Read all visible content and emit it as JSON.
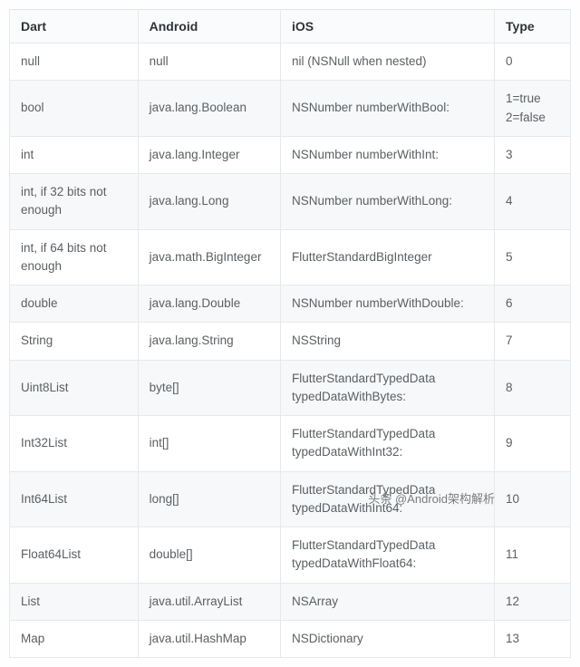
{
  "table": {
    "headers": [
      "Dart",
      "Android",
      "iOS",
      "Type"
    ],
    "rows": [
      {
        "dart": "null",
        "android": "null",
        "ios": "nil (NSNull when nested)",
        "type": "0"
      },
      {
        "dart": "bool",
        "android": "java.lang.Boolean",
        "ios": "NSNumber numberWithBool:",
        "type": "1=true\n2=false"
      },
      {
        "dart": "int",
        "android": "java.lang.Integer",
        "ios": "NSNumber numberWithInt:",
        "type": "3"
      },
      {
        "dart": "int, if 32 bits not enough",
        "android": "java.lang.Long",
        "ios": "NSNumber numberWithLong:",
        "type": "4"
      },
      {
        "dart": "int, if 64 bits not enough",
        "android": "java.math.BigInteger",
        "ios": "FlutterStandardBigInteger",
        "type": "5"
      },
      {
        "dart": "double",
        "android": "java.lang.Double",
        "ios": "NSNumber numberWithDouble:",
        "type": "6"
      },
      {
        "dart": "String",
        "android": "java.lang.String",
        "ios": "NSString",
        "type": "7"
      },
      {
        "dart": "Uint8List",
        "android": "byte[]",
        "ios": "FlutterStandardTypedData typedDataWithBytes:",
        "type": "8"
      },
      {
        "dart": "Int32List",
        "android": "int[]",
        "ios": "FlutterStandardTypedData typedDataWithInt32:",
        "type": "9"
      },
      {
        "dart": "Int64List",
        "android": "long[]",
        "ios": "FlutterStandardTypedData typedDataWithInt64:",
        "type": "10"
      },
      {
        "dart": "Float64List",
        "android": "double[]",
        "ios": "FlutterStandardTypedData typedDataWithFloat64:",
        "type": "11"
      },
      {
        "dart": "List",
        "android": "java.util.ArrayList",
        "ios": "NSArray",
        "type": "12"
      },
      {
        "dart": "Map",
        "android": "java.util.HashMap",
        "ios": "NSDictionary",
        "type": "13"
      }
    ]
  },
  "watermark": "头条 @Android架构解析"
}
